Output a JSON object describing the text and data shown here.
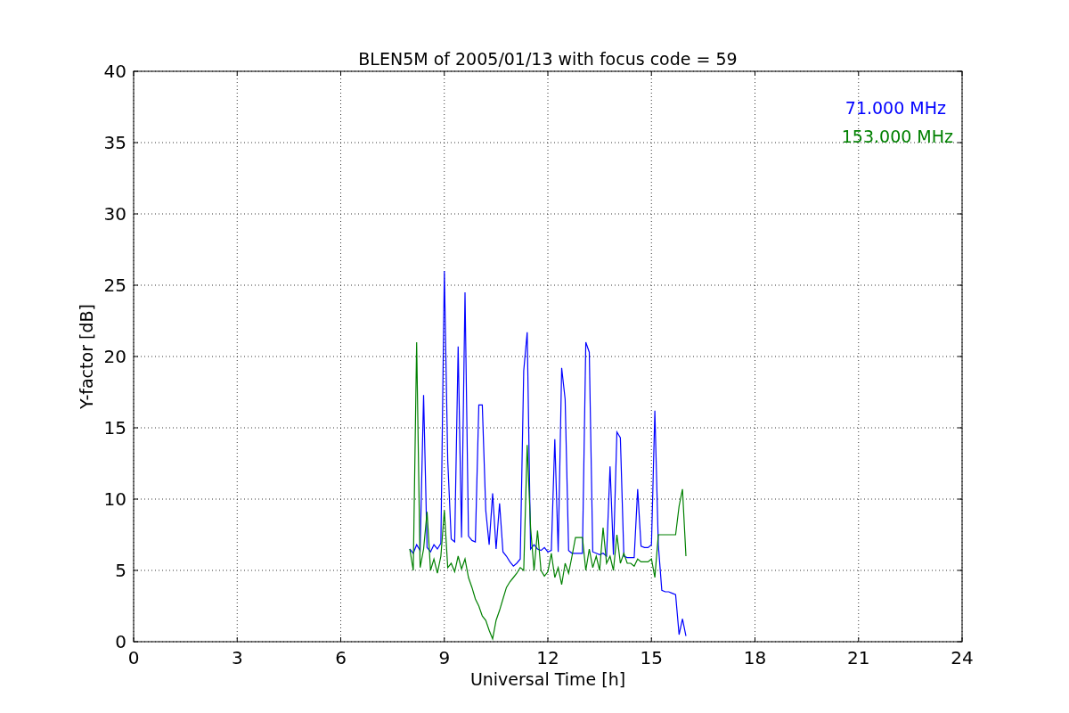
{
  "figure": {
    "chart_data": {
      "type": "line",
      "title": "BLEN5M of 2005/01/13 with focus code = 59",
      "xlabel": "Universal Time [h]",
      "ylabel": "Y-factor [dB]",
      "grid": true,
      "xlim": [
        0,
        24
      ],
      "ylim": [
        0,
        40
      ],
      "xticks": [
        0,
        3,
        6,
        9,
        12,
        15,
        18,
        21,
        24
      ],
      "yticks": [
        0,
        5,
        10,
        15,
        20,
        25,
        30,
        35,
        40
      ],
      "x": [
        8.0,
        8.1,
        8.2,
        8.3,
        8.4,
        8.5,
        8.6,
        8.7,
        8.8,
        8.9,
        9.0,
        9.1,
        9.2,
        9.3,
        9.4,
        9.5,
        9.6,
        9.7,
        9.8,
        9.9,
        10.0,
        10.1,
        10.2,
        10.3,
        10.4,
        10.5,
        10.6,
        10.7,
        10.8,
        10.9,
        11.0,
        11.1,
        11.2,
        11.3,
        11.4,
        11.5,
        11.6,
        11.7,
        11.8,
        11.9,
        12.0,
        12.1,
        12.2,
        12.3,
        12.4,
        12.5,
        12.6,
        12.7,
        12.8,
        12.9,
        13.0,
        13.1,
        13.2,
        13.3,
        13.4,
        13.5,
        13.6,
        13.7,
        13.8,
        13.9,
        14.0,
        14.1,
        14.2,
        14.3,
        14.4,
        14.5,
        14.6,
        14.7,
        14.8,
        14.9,
        15.0,
        15.1,
        15.2,
        15.3,
        15.4,
        15.5,
        15.6,
        15.7,
        15.8,
        15.9,
        16.0
      ],
      "series": [
        {
          "name": "71.000 MHz",
          "color": "#0000ff",
          "values": [
            6.5,
            6.2,
            6.8,
            6.4,
            17.3,
            6.6,
            6.3,
            6.8,
            6.5,
            6.9,
            26,
            12.7,
            7.2,
            7.0,
            20.7,
            7.3,
            24.5,
            7.4,
            7.1,
            7.0,
            16.6,
            16.6,
            9.2,
            6.8,
            10.4,
            6.5,
            9.7,
            6.3,
            6.0,
            5.6,
            5.3,
            5.5,
            5.8,
            19.0,
            21.7,
            6.5,
            6.8,
            6.5,
            6.4,
            6.6,
            6.3,
            6.4,
            14.2,
            6.3,
            19.2,
            17.0,
            6.4,
            6.2,
            6.2,
            6.2,
            6.2,
            21.0,
            20.3,
            6.3,
            6.2,
            6.1,
            6.2,
            6.0,
            12.3,
            6.1,
            14.7,
            14.3,
            6.0,
            5.9,
            5.9,
            5.9,
            10.7,
            6.7,
            6.6,
            6.6,
            6.8,
            16.2,
            6.8,
            3.6,
            3.5,
            3.5,
            3.4,
            3.3,
            0.5,
            1.6,
            0.4
          ]
        },
        {
          "name": "153.000 MHz",
          "color": "#008000",
          "values": [
            6.5,
            5.0,
            21.0,
            5.2,
            6.5,
            9.1,
            5.0,
            5.8,
            4.8,
            6.0,
            9.2,
            5.2,
            5.5,
            4.9,
            6.0,
            5.1,
            5.8,
            4.5,
            3.8,
            3.0,
            2.5,
            1.8,
            1.5,
            0.8,
            0.2,
            1.5,
            2.2,
            3.0,
            3.8,
            4.2,
            4.5,
            4.8,
            5.2,
            5.0,
            13.8,
            8.0,
            5.0,
            7.8,
            5.0,
            4.6,
            4.9,
            6.2,
            4.5,
            5.2,
            4.0,
            5.5,
            4.8,
            6.0,
            7.3,
            7.3,
            7.3,
            5.0,
            6.5,
            5.2,
            6.0,
            5.0,
            8.0,
            5.5,
            6.0,
            5.0,
            7.5,
            5.5,
            6.2,
            5.5,
            5.5,
            5.3,
            5.8,
            5.6,
            5.6,
            5.6,
            5.8,
            4.5,
            7.5,
            7.5,
            7.5,
            7.5,
            7.5,
            7.5,
            9.5,
            10.7,
            6.0
          ]
        }
      ]
    }
  }
}
